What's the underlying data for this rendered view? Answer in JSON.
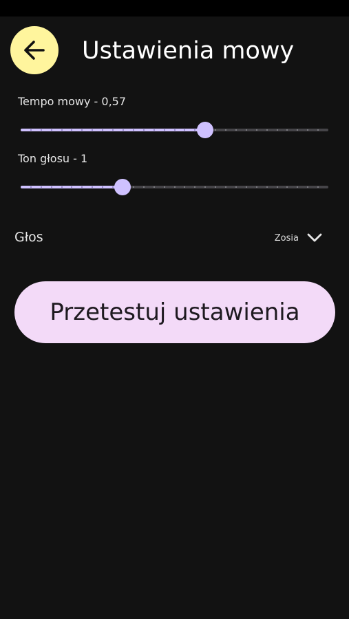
{
  "header": {
    "title": "Ustawienia mowy",
    "back_icon": "arrow-left-icon"
  },
  "speech_rate": {
    "label": "Tempo mowy - 0,57",
    "value": 0.6,
    "steps": 30
  },
  "pitch": {
    "label": "Ton głosu - 1",
    "value": 0.33,
    "steps": 30
  },
  "voice": {
    "label": "Głos",
    "selected": "Zosia",
    "dropdown_icon": "chevron-down-icon"
  },
  "actions": {
    "test_label": "Przetestuj ustawienia"
  },
  "colors": {
    "accent": "#CFC1FF",
    "back_button": "#FFF59D",
    "test_button": "#F3DAF8",
    "background": "#121212"
  }
}
